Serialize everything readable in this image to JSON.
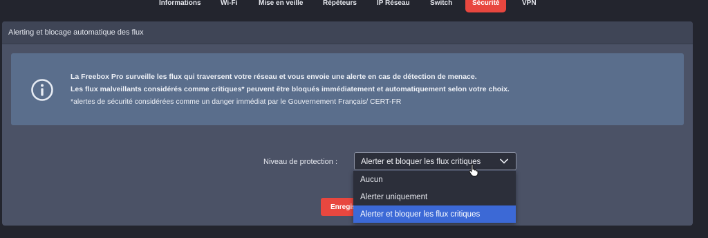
{
  "tabs": [
    {
      "label": "Informations"
    },
    {
      "label": "Wi-Fi"
    },
    {
      "label": "Mise en veille"
    },
    {
      "label": "Répéteurs"
    },
    {
      "label": "IP Réseau"
    },
    {
      "label": "Switch"
    },
    {
      "label": "Sécurité",
      "active": true
    },
    {
      "label": "VPN"
    }
  ],
  "panel": {
    "title": "Alerting et blocage automatique des flux",
    "info_lines": [
      "La Freebox Pro surveille les flux qui traversent votre réseau et vous envoie une alerte en cas de détection de menace.",
      "Les flux malveillants considérés comme critiques* peuvent être bloqués immédiatement et automatiquement selon votre choix.",
      "*alertes de sécurité considérées comme un danger immédiat par le Gouvernement Français/ CERT-FR"
    ],
    "protection_label": "Niveau de protection :",
    "protection_selected": "Alerter et bloquer les flux critiques",
    "protection_options": [
      "Aucun",
      "Alerter uniquement",
      "Alerter et bloquer les flux critiques"
    ],
    "highlighted_option": "Alerter et bloquer les flux critiques",
    "save_label": "Enregistrer"
  },
  "colors": {
    "accent": "#e8473f",
    "info_bg": "#5a6e8c",
    "highlight": "#3c69d6"
  }
}
